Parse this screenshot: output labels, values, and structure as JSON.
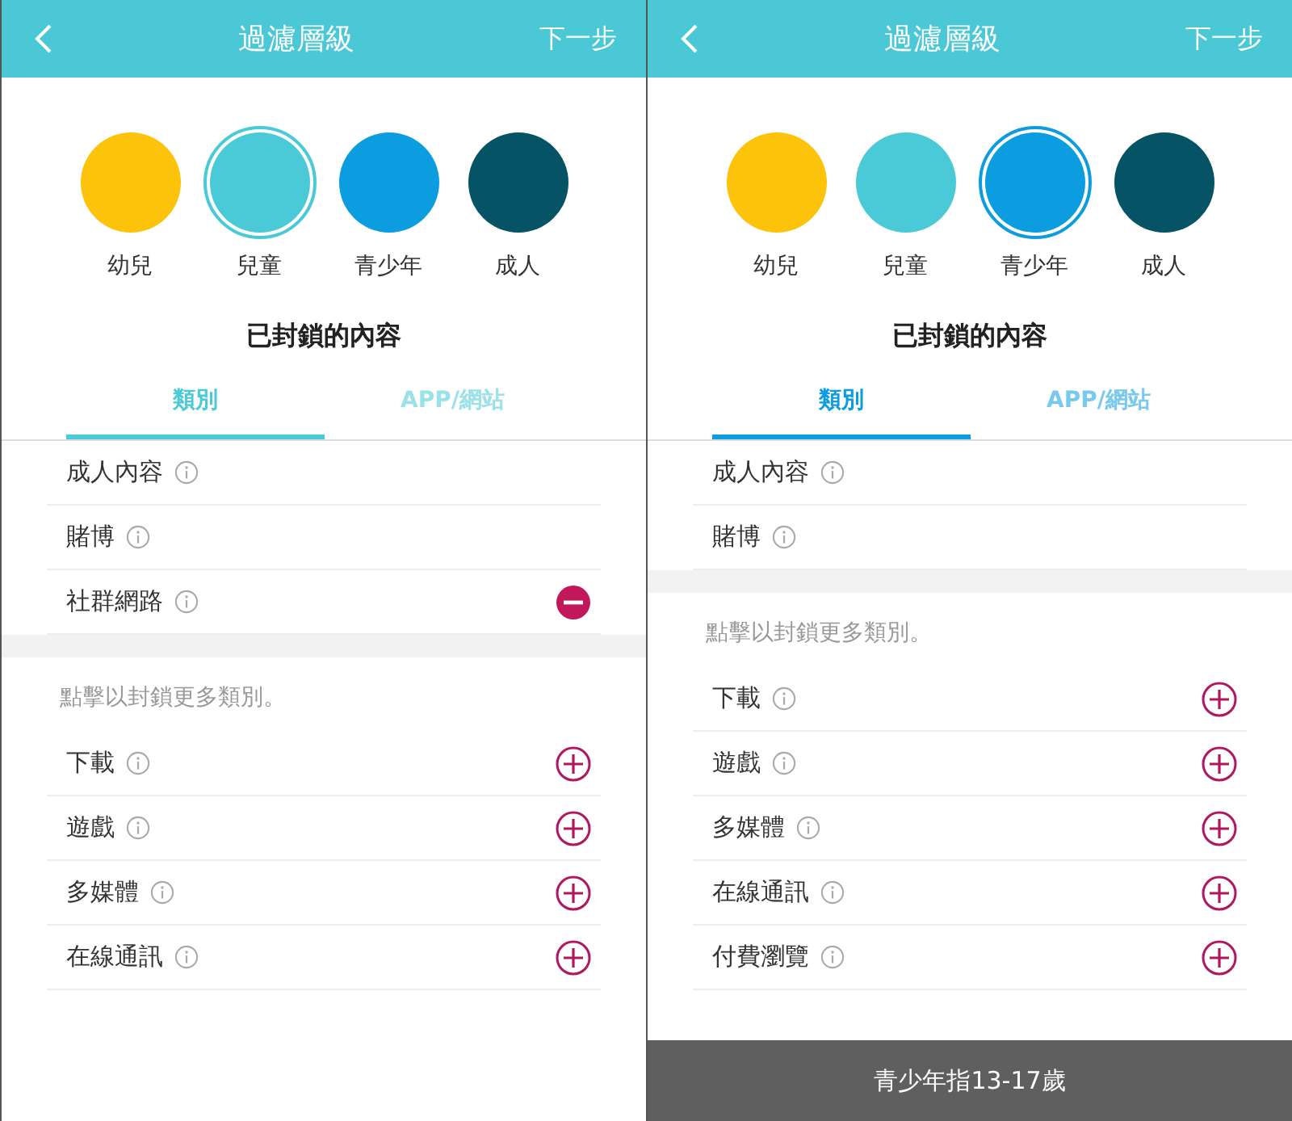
{
  "screens": [
    {
      "header": {
        "title": "過濾層級",
        "next": "下一步"
      },
      "levels": [
        {
          "label": "幼兒",
          "color": "#fcc30a",
          "selected": false
        },
        {
          "label": "兒童",
          "color": "#4ac9d6",
          "selected": true
        },
        {
          "label": "青少年",
          "color": "#0b9ddf",
          "selected": false
        },
        {
          "label": "成人",
          "color": "#075366",
          "selected": false
        }
      ],
      "section_title": "已封鎖的內容",
      "tabs": [
        {
          "label": "類別",
          "selected": true
        },
        {
          "label": "APP/網站",
          "selected": false
        }
      ],
      "blocked": [
        {
          "label": "成人內容",
          "kind": "fixed"
        },
        {
          "label": "賭博",
          "kind": "fixed"
        },
        {
          "label": "社群網路",
          "kind": "remove"
        }
      ],
      "hint": "點擊以封鎖更多類別。",
      "more": [
        {
          "label": "下載",
          "kind": "add"
        },
        {
          "label": "遊戲",
          "kind": "add"
        },
        {
          "label": "多媒體",
          "kind": "add"
        },
        {
          "label": "在線通訊",
          "kind": "add"
        }
      ]
    },
    {
      "header": {
        "title": "過濾層級",
        "next": "下一步"
      },
      "levels": [
        {
          "label": "幼兒",
          "color": "#fcc30a",
          "selected": false
        },
        {
          "label": "兒童",
          "color": "#4ac9d6",
          "selected": false
        },
        {
          "label": "青少年",
          "color": "#0b9ddf",
          "selected": true
        },
        {
          "label": "成人",
          "color": "#075366",
          "selected": false
        }
      ],
      "section_title": "已封鎖的內容",
      "tabs": [
        {
          "label": "類別",
          "selected": true
        },
        {
          "label": "APP/網站",
          "selected": false
        }
      ],
      "blocked": [
        {
          "label": "成人內容",
          "kind": "fixed"
        },
        {
          "label": "賭博",
          "kind": "fixed"
        }
      ],
      "hint": "點擊以封鎖更多類別。",
      "more": [
        {
          "label": "下載",
          "kind": "add"
        },
        {
          "label": "遊戲",
          "kind": "add"
        },
        {
          "label": "多媒體",
          "kind": "add"
        },
        {
          "label": "在線通訊",
          "kind": "add"
        },
        {
          "label": "付費瀏覽",
          "kind": "add"
        }
      ],
      "toast": "青少年指13-17歲"
    }
  ]
}
